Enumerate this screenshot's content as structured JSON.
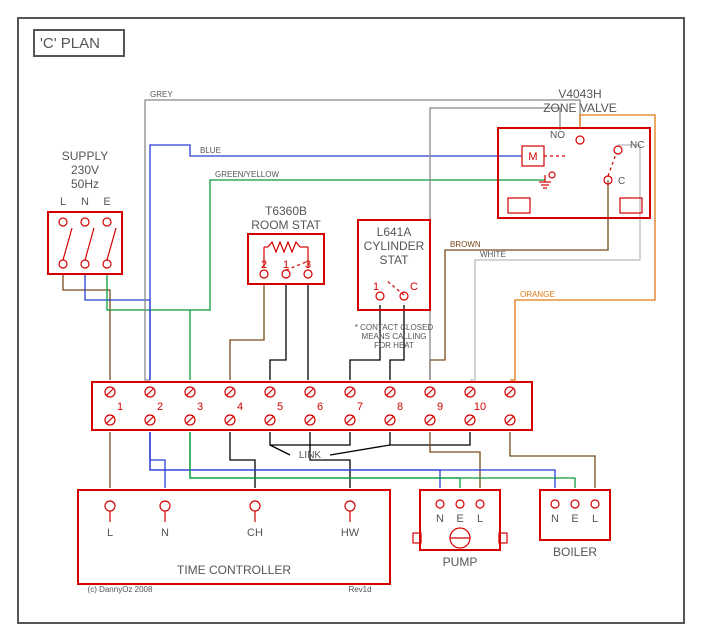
{
  "title": "'C' PLAN",
  "supply": {
    "label": "SUPPLY",
    "voltage": "230V",
    "freq": "50Hz",
    "L": "L",
    "N": "N",
    "E": "E"
  },
  "roomstat": {
    "model": "T6360B",
    "label": "ROOM STAT",
    "t1": "2",
    "t2": "1",
    "t3": "3"
  },
  "cylstat": {
    "model": "L641A",
    "label1": "CYLINDER",
    "label2": "STAT",
    "t1": "1",
    "t2": "C",
    "note1": "* CONTACT CLOSED",
    "note2": "MEANS CALLING",
    "note3": "FOR HEAT"
  },
  "zonevalve": {
    "model": "V4043H",
    "label": "ZONE VALVE",
    "M": "M",
    "NO": "NO",
    "NC": "NC",
    "C": "C"
  },
  "junction": {
    "links_label": "LINK",
    "terms": [
      "1",
      "2",
      "3",
      "4",
      "5",
      "6",
      "7",
      "8",
      "9",
      "10"
    ]
  },
  "timectrl": {
    "label": "TIME CONTROLLER",
    "L": "L",
    "N": "N",
    "CH": "CH",
    "HW": "HW"
  },
  "pump": {
    "label": "PUMP",
    "N": "N",
    "E": "E",
    "L": "L"
  },
  "boiler": {
    "label": "BOILER",
    "N": "N",
    "E": "E",
    "L": "L"
  },
  "wires": {
    "grey": "GREY",
    "blue": "BLUE",
    "greenyellow": "GREEN/YELLOW",
    "brown": "BROWN",
    "white": "WHITE",
    "orange": "ORANGE"
  },
  "credits": {
    "copyright": "(c) DannyOz 2008",
    "rev": "Rev1d"
  }
}
